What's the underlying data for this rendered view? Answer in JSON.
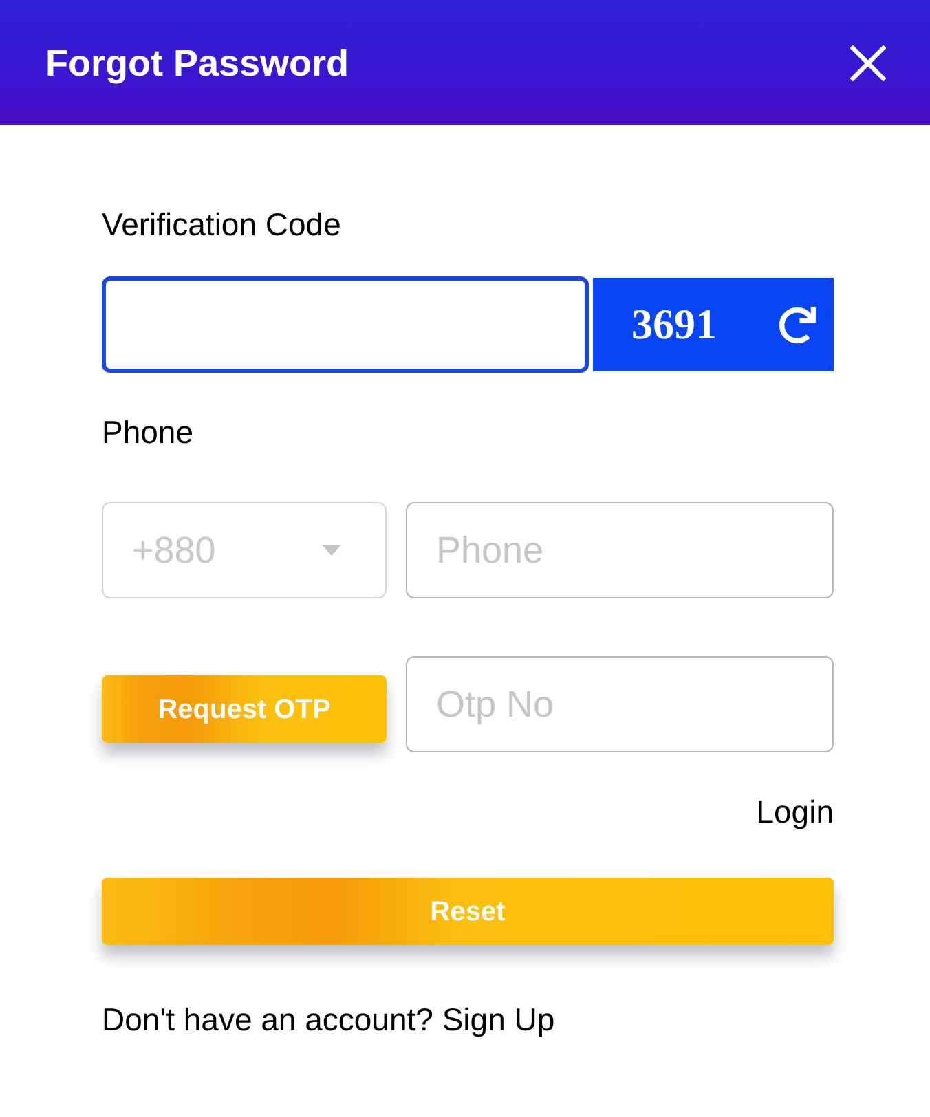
{
  "window": {
    "title": "Forgot Password"
  },
  "verification": {
    "label": "Verification Code",
    "focused": true,
    "captcha": "3691"
  },
  "phone": {
    "label": "Phone",
    "country_code": "+880",
    "placeholder": "Phone"
  },
  "otp": {
    "button": "Request OTP",
    "placeholder": "Otp No"
  },
  "login_link": "Login",
  "reset_button": "Reset",
  "signup": {
    "text": "Don't have an account?",
    "link": "Sign Up"
  }
}
